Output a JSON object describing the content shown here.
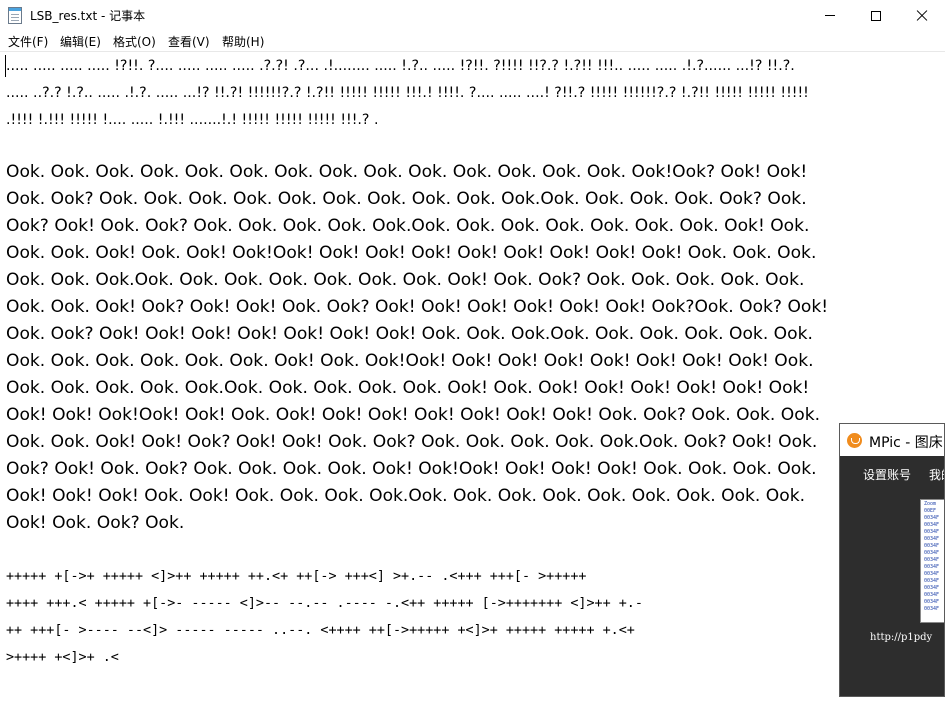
{
  "window": {
    "title": "LSB_res.txt - 记事本",
    "icon": "notepad-icon",
    "controls": [
      "minimize-icon",
      "maximize-icon",
      "close-icon"
    ]
  },
  "menubar": {
    "items": [
      "文件(F)",
      "编辑(E)",
      "格式(O)",
      "查看(V)",
      "帮助(H)"
    ]
  },
  "editor": {
    "dots_lines": [
      "..... ..... ..... ..... !?!!. ?.... ..... ..... ..... .?.?! .?... .!........ ..... !.?.. ..... !?!!. ?!!!! !!?.? !.?!! !!!.. ..... ..... .!.?...... ...!? !!.?.",
      "..... ..?.? !.?.. ..... .!.?. ..... ...!? !!.?! !!!!!!?.? !.?!! !!!!! !!!!! !!!.! !!!!. ?.... ..... ....! ?!!.? !!!!! !!!!!!?.? !.?!! !!!!! !!!!! !!!!!",
      ".!!!! !.!!! !!!!! !.... ..... !.!!! .......!.! !!!!! !!!!! !!!!! !!!.? ."
    ],
    "ook_lines": [
      "Ook. Ook. Ook. Ook. Ook. Ook. Ook. Ook. Ook. Ook. Ook. Ook. Ook. Ook. Ook!Ook? Ook! Ook!",
      "Ook. Ook? Ook. Ook. Ook. Ook. Ook. Ook. Ook. Ook. Ook. Ook.Ook. Ook. Ook. Ook. Ook? Ook.",
      "Ook? Ook! Ook. Ook? Ook. Ook. Ook. Ook. Ook.Ook. Ook. Ook. Ook. Ook. Ook. Ook. Ook! Ook.",
      "Ook. Ook. Ook! Ook. Ook! Ook!Ook! Ook! Ook! Ook! Ook! Ook! Ook! Ook! Ook! Ook. Ook. Ook.",
      "Ook. Ook. Ook.Ook. Ook. Ook. Ook. Ook. Ook. Ook. Ook! Ook. Ook? Ook. Ook. Ook. Ook. Ook.",
      "Ook. Ook. Ook! Ook? Ook! Ook! Ook. Ook? Ook! Ook! Ook! Ook! Ook! Ook! Ook?Ook. Ook? Ook!",
      "Ook. Ook? Ook! Ook! Ook! Ook! Ook! Ook! Ook! Ook. Ook. Ook.Ook. Ook. Ook. Ook. Ook. Ook.",
      "Ook. Ook. Ook. Ook. Ook. Ook. Ook! Ook. Ook!Ook! Ook! Ook! Ook! Ook! Ook! Ook! Ook! Ook.",
      "Ook. Ook. Ook. Ook. Ook.Ook. Ook. Ook. Ook. Ook. Ook! Ook. Ook! Ook! Ook! Ook! Ook! Ook!",
      "Ook! Ook! Ook!Ook! Ook! Ook. Ook! Ook! Ook! Ook! Ook! Ook! Ook! Ook. Ook? Ook. Ook. Ook.",
      "Ook. Ook. Ook! Ook! Ook? Ook! Ook! Ook. Ook? Ook. Ook. Ook. Ook. Ook.Ook. Ook? Ook! Ook.",
      "Ook? Ook! Ook. Ook? Ook. Ook. Ook. Ook. Ook! Ook!Ook! Ook! Ook! Ook! Ook. Ook. Ook. Ook.",
      "Ook! Ook! Ook! Ook. Ook! Ook. Ook. Ook. Ook.Ook. Ook. Ook. Ook. Ook. Ook. Ook. Ook. Ook.",
      "Ook! Ook. Ook? Ook."
    ],
    "bf_lines": [
      "+++++ +[->+ +++++ <]>++ +++++ ++.<+ ++[-> +++<] >+.-- .<+++ +++[- >+++++",
      "++++ +++.< +++++ +[->- ----- <]>-- --.-- .---- -.<++ +++++ [->+++++++ <]>++ +.-",
      "++ +++[- >---- --<]> ----- ----- ..--. <++++ ++[->+++++ +<]>+ +++++ +++++ +.<+",
      ">++++ +<]>+ .<"
    ]
  },
  "mpic": {
    "title": "MPic - 图床",
    "icon": "mpic-logo-icon",
    "menu": [
      "设置账号",
      "我的"
    ],
    "thumbnail_rows": [
      "Zoom",
      "00EF",
      "0034F",
      "0034F",
      "0034F",
      "0034F",
      "0034F",
      "0034F",
      "0034F",
      "0034F",
      "0034F",
      "0034F",
      "0034F",
      "0034F",
      "0034F",
      "0034F"
    ],
    "url_text": "http://p1pdy"
  }
}
